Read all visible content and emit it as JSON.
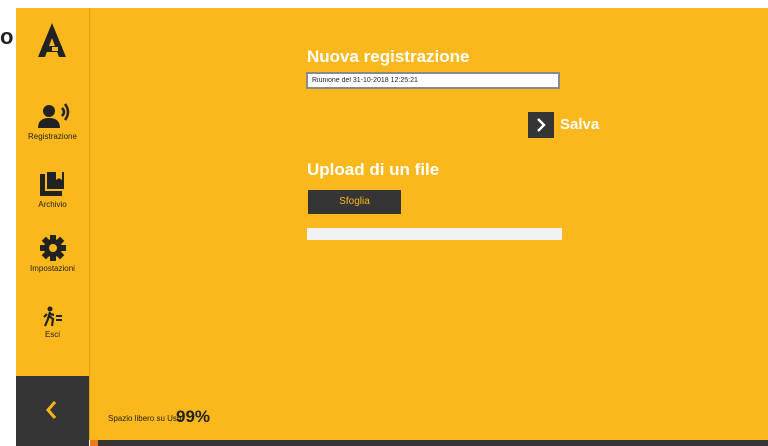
{
  "stray_text": "o",
  "nav": {
    "items": [
      {
        "label": "Registrazione",
        "icon": "person-speaking-icon"
      },
      {
        "label": "Archivio",
        "icon": "archive-icon"
      },
      {
        "label": "Impostazioni",
        "icon": "gear-icon"
      },
      {
        "label": "Esci",
        "icon": "exit-icon"
      }
    ],
    "back_icon": "chevron-left-icon"
  },
  "recording": {
    "title": "Nuova registrazione",
    "input_value": "Riunione del 31-10-2018 12:25:21",
    "save_label": "Salva"
  },
  "upload": {
    "title": "Upload di un file",
    "browse_label": "Sfoglia",
    "progress": 0
  },
  "footer": {
    "usb_label": "Spazio libero su Usb",
    "usb_value": "99%"
  },
  "colors": {
    "accent": "#fbb81c",
    "dark": "#353535",
    "orange": "#f07a1a"
  }
}
